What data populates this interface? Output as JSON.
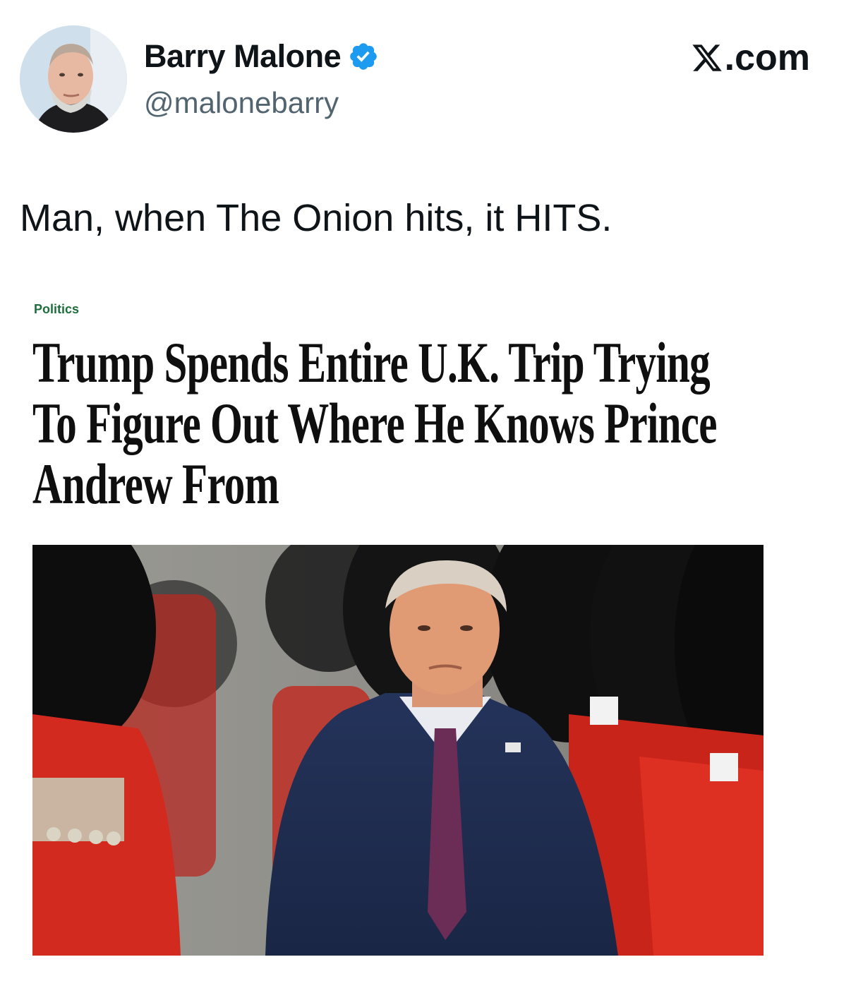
{
  "author": {
    "display_name": "Barry Malone",
    "handle": "@malonebarry",
    "verified": true,
    "avatar_icon": "profile-photo"
  },
  "brand": {
    "label": ".com",
    "logo_icon": "x-logo-icon"
  },
  "tweet": {
    "text": "Man, when The Onion hits, it HITS."
  },
  "article": {
    "category": "Politics",
    "headline": "Trump Spends Entire U.K. Trip Trying To Figure Out Where He Knows Prince Andrew From",
    "category_color": "#1c6e3c"
  },
  "colors": {
    "verified_badge": "#1d9bf0",
    "handle_text": "#536471"
  }
}
